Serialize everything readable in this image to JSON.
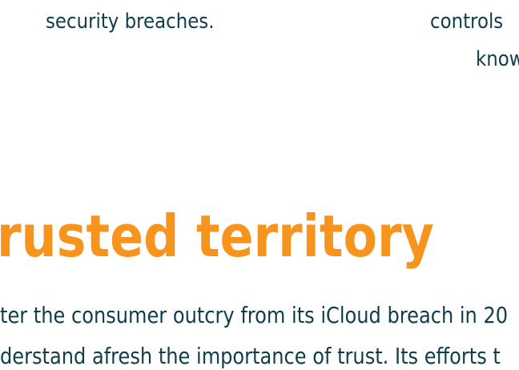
{
  "colors": {
    "text": "#0f3d4c",
    "heading": "#f7941d",
    "background": "#ffffff"
  },
  "column_left": {
    "line_1": "security breaches."
  },
  "column_right": {
    "line_1": "controls",
    "line_2": "know"
  },
  "section": {
    "heading": "rusted territory",
    "body_lines": [
      "ter the consumer outcry from its iCloud breach in 20",
      "derstand afresh the importance of trust. Its efforts t"
    ]
  }
}
